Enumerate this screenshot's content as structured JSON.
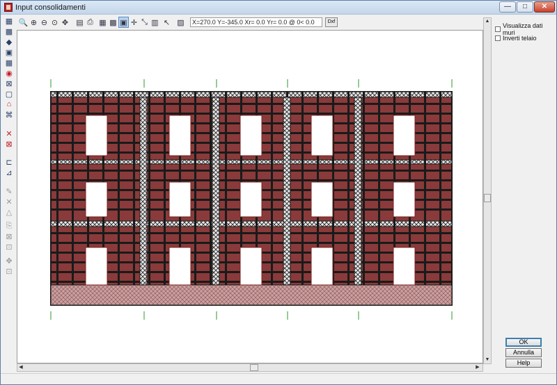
{
  "window": {
    "title": "Input consolidamenti",
    "controls": {
      "minimize": "—",
      "maximize": "□",
      "close": "✕"
    }
  },
  "left_toolbar": [
    {
      "icon": "frame-view-icon",
      "glyph": "▦"
    },
    {
      "icon": "grid-view-icon",
      "glyph": "▩"
    },
    {
      "icon": "cube-icon",
      "glyph": "◆"
    },
    {
      "icon": "panel-icon",
      "glyph": "▣"
    },
    {
      "icon": "pattern-icon",
      "glyph": "▦"
    },
    {
      "icon": "ring-icon",
      "glyph": "◉"
    },
    {
      "icon": "cross-panel-icon",
      "glyph": "⊠"
    },
    {
      "icon": "square-icon",
      "glyph": "▢"
    },
    {
      "icon": "arch-icon",
      "glyph": "⌂"
    },
    {
      "icon": "network-icon",
      "glyph": "⌘"
    },
    {
      "icon": "delete-icon",
      "glyph": "✕"
    },
    {
      "icon": "delete-box-icon",
      "glyph": "⊠"
    },
    {
      "icon": "beam-icon",
      "glyph": "⊏"
    },
    {
      "icon": "measure-icon",
      "glyph": "⊿"
    },
    {
      "icon": "edit-icon",
      "glyph": "✎"
    },
    {
      "icon": "cross-disabled-icon",
      "glyph": "✕"
    },
    {
      "icon": "triangle-icon",
      "glyph": "△"
    },
    {
      "icon": "copy-icon",
      "glyph": "⎘"
    },
    {
      "icon": "diag-box-icon",
      "glyph": "⊠"
    },
    {
      "icon": "sub-box-icon",
      "glyph": "⊡"
    },
    {
      "icon": "move-icon",
      "glyph": "✥"
    },
    {
      "icon": "small-box-icon",
      "glyph": "⊡"
    }
  ],
  "top_toolbar": [
    {
      "icon": "zoom-window-icon",
      "glyph": "🔍"
    },
    {
      "icon": "zoom-in-icon",
      "glyph": "⊕"
    },
    {
      "icon": "zoom-out-icon",
      "glyph": "⊖"
    },
    {
      "icon": "zoom-all-icon",
      "glyph": "⊙"
    },
    {
      "icon": "pan-icon",
      "glyph": "✥"
    },
    {
      "icon": "export-icon",
      "glyph": "▤"
    },
    {
      "icon": "print-icon",
      "glyph": "⎙"
    },
    {
      "icon": "grid-small-icon",
      "glyph": "▦"
    },
    {
      "icon": "grid-large-icon",
      "glyph": "▩"
    },
    {
      "icon": "grid-snap-icon",
      "glyph": "▣"
    },
    {
      "icon": "snap-point-icon",
      "glyph": "✛"
    },
    {
      "icon": "scale-icon",
      "glyph": "⤡"
    },
    {
      "icon": "measure-icon",
      "glyph": "▥"
    },
    {
      "icon": "select-icon",
      "glyph": "↖"
    },
    {
      "icon": "info-icon",
      "glyph": "▨"
    }
  ],
  "coordinates": "X=270.0 Y=-345.0 Xr= 0.0 Yr= 0.0 @ 0< 0.0",
  "dxf_label": "Dxf",
  "options": {
    "show_wall_data": "Visualizza dati muri",
    "invert_frame": "Inverti telaio"
  },
  "buttons": {
    "ok": "OK",
    "cancel": "Annulla",
    "help": "Help"
  },
  "colors": {
    "wall": "#8a3a3a",
    "frame": "#1a1a1a",
    "foundation": "#c9a0a0",
    "axis": "#2a9a2a"
  }
}
